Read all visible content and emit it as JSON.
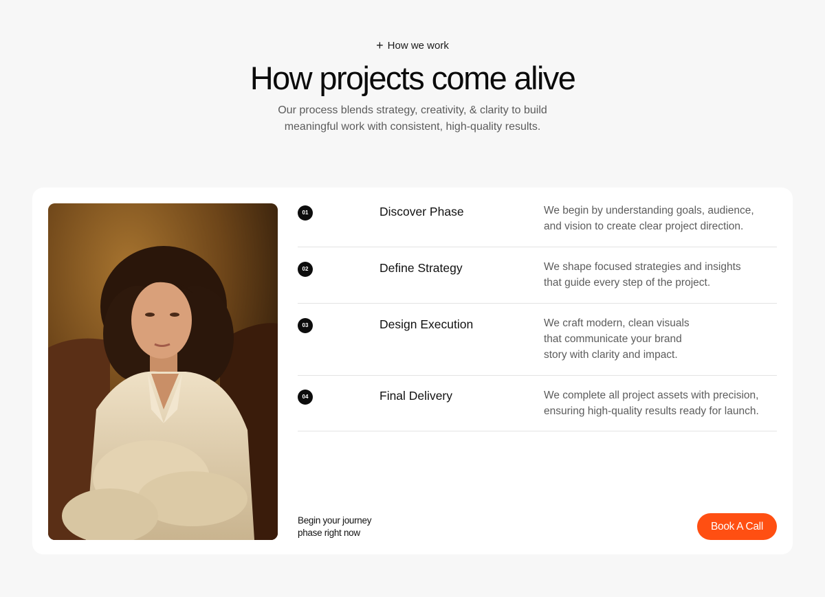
{
  "header": {
    "eyebrow_icon": "plus-icon",
    "eyebrow": "How we work",
    "title": "How projects come alive",
    "subtitle_line1": "Our process blends strategy, creativity, & clarity to build",
    "subtitle_line2": "meaningful work with consistent, high-quality results."
  },
  "steps": [
    {
      "number": "01",
      "name": "Discover Phase",
      "desc_lines": [
        "We begin by understanding goals, audience,",
        "and vision to create clear project direction."
      ]
    },
    {
      "number": "02",
      "name": "Define Strategy",
      "desc_lines": [
        "We shape focused strategies and insights",
        "that guide every step of the project."
      ]
    },
    {
      "number": "03",
      "name": "Design Execution",
      "desc_lines": [
        "We craft modern, clean visuals",
        "that communicate your brand",
        "story with clarity and impact."
      ]
    },
    {
      "number": "04",
      "name": "Final Delivery",
      "desc_lines": [
        "We complete all project assets with precision,",
        "ensuring high-quality results ready for launch."
      ]
    }
  ],
  "cta": {
    "text_line1": "Begin your journey",
    "text_line2": "phase right now",
    "button_label": "Book A Call"
  },
  "colors": {
    "accent": "#ff4f12",
    "background": "#f7f7f7",
    "card": "#ffffff",
    "badge": "#0d0d0d"
  }
}
